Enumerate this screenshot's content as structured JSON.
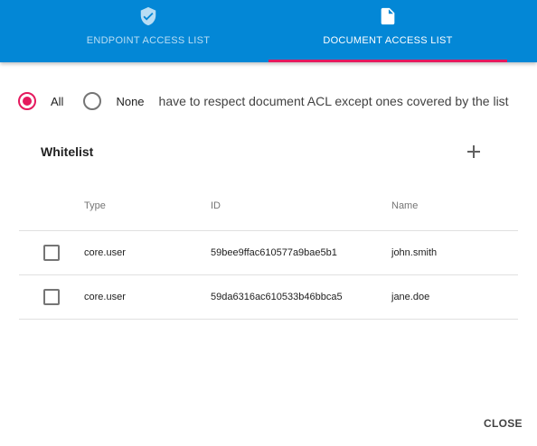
{
  "tabs": [
    {
      "label": "ENDPOINT ACCESS LIST",
      "icon": "shield-check-icon",
      "active": false
    },
    {
      "label": "DOCUMENT ACCESS LIST",
      "icon": "document-icon",
      "active": true
    }
  ],
  "mode": {
    "options": [
      {
        "label": "All",
        "checked": true
      },
      {
        "label": "None",
        "checked": false
      }
    ],
    "description": "have to respect document ACL except ones covered by the list"
  },
  "whitelist": {
    "title": "Whitelist",
    "add_icon": "plus-icon",
    "columns": [
      "Type",
      "ID",
      "Name"
    ],
    "rows": [
      {
        "checked": false,
        "type": "core.user",
        "id": "59bee9ffac610577a9bae5b1",
        "name": "john.smith"
      },
      {
        "checked": false,
        "type": "core.user",
        "id": "59da6316ac610533b46bbca5",
        "name": "jane.doe"
      }
    ]
  },
  "footer": {
    "close_label": "CLOSE"
  },
  "colors": {
    "tabbar": "#0387d6",
    "accent": "#e5195e"
  }
}
